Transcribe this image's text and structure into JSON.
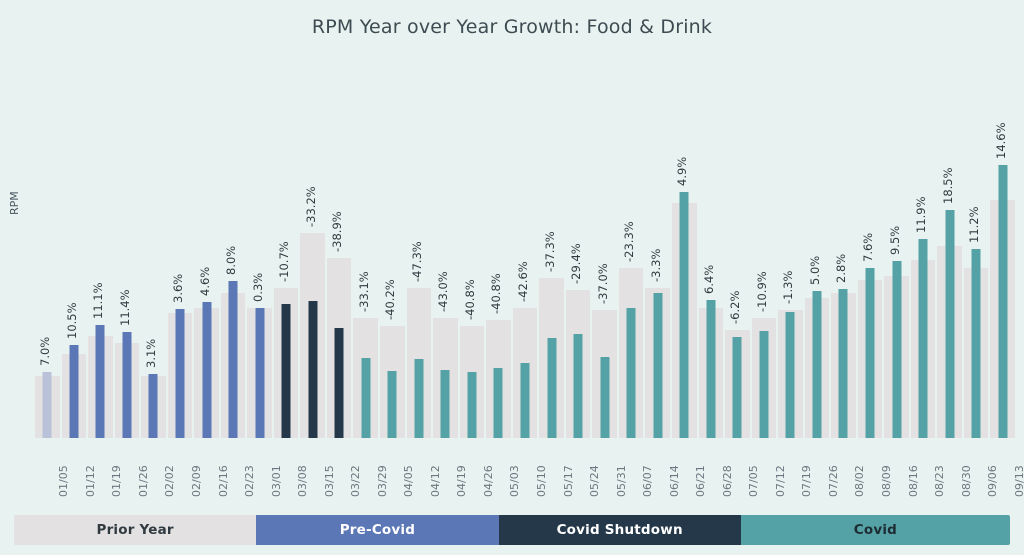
{
  "chart_data": {
    "type": "bar",
    "title": "RPM Year over Year Growth: Food & Drink",
    "xlabel": "",
    "ylabel": "RPM",
    "grid": false,
    "legend_position": "bottom",
    "categories": [
      "01/05",
      "01/12",
      "01/19",
      "01/26",
      "02/02",
      "02/09",
      "02/16",
      "02/23",
      "03/01",
      "03/08",
      "03/15",
      "03/22",
      "03/29",
      "04/05",
      "04/12",
      "04/19",
      "04/26",
      "05/03",
      "05/10",
      "05/17",
      "05/24",
      "05/31",
      "06/07",
      "06/14",
      "06/21",
      "06/28",
      "07/05",
      "07/12",
      "07/19",
      "07/26",
      "08/02",
      "08/09",
      "08/16",
      "08/23",
      "08/30",
      "09/06",
      "09/13"
    ],
    "series": [
      {
        "name": "Prior Year",
        "type": "background-bar",
        "color": "#e3e1e1",
        "values": [
          62,
          84,
          102,
          95,
          62,
          125,
          130,
          145,
          130,
          150,
          205,
          180,
          120,
          112,
          150,
          120,
          112,
          118,
          130,
          160,
          148,
          128,
          170,
          150,
          235,
          130,
          108,
          120,
          128,
          140,
          145,
          158,
          162,
          178,
          192,
          170,
          238
        ]
      },
      {
        "name": "Year over Year Growth",
        "type": "value-bar",
        "data_labels": [
          "7.0%",
          "10.5%",
          "11.1%",
          "11.4%",
          "3.1%",
          "3.6%",
          "4.6%",
          "8.0%",
          "0.3%",
          "-10.7%",
          "-33.2%",
          "-38.9%",
          "-33.1%",
          "-40.2%",
          "-47.3%",
          "-43.0%",
          "-40.8%",
          "-40.8%",
          "-42.6%",
          "-37.3%",
          "-29.4%",
          "-37.0%",
          "-23.3%",
          "-3.3%",
          "4.9%",
          "6.4%",
          "-6.2%",
          "-10.9%",
          "-1.3%",
          "5.0%",
          "2.8%",
          "7.6%",
          "9.5%",
          "11.9%",
          "18.5%",
          "11.2%",
          "14.6%"
        ],
        "values": [
          7.0,
          10.5,
          11.1,
          11.4,
          3.1,
          3.6,
          4.6,
          8.0,
          0.3,
          -10.7,
          -33.2,
          -38.9,
          -33.1,
          -40.2,
          -47.3,
          -43.0,
          -40.8,
          -40.8,
          -42.6,
          -37.3,
          -29.4,
          -37.0,
          -23.3,
          -3.3,
          4.9,
          6.4,
          -6.2,
          -10.9,
          -1.3,
          5.0,
          2.8,
          7.6,
          9.5,
          11.9,
          18.5,
          11.2,
          14.6
        ],
        "segments": [
          "prior",
          "pre",
          "pre",
          "pre",
          "pre",
          "pre",
          "pre",
          "pre",
          "pre",
          "shut",
          "shut",
          "shut",
          "covid",
          "covid",
          "covid",
          "covid",
          "covid",
          "covid",
          "covid",
          "covid",
          "covid",
          "covid",
          "covid",
          "covid",
          "covid",
          "covid",
          "covid",
          "covid",
          "covid",
          "covid",
          "covid",
          "covid",
          "covid",
          "covid",
          "covid",
          "covid",
          "covid"
        ]
      }
    ],
    "legend": [
      {
        "key": "prior",
        "label": "Prior Year",
        "color": "#e3e1e1",
        "text_color": "#303a40",
        "span": 9
      },
      {
        "key": "pre",
        "label": "Pre-Covid",
        "color": "#5b77b5",
        "text_color": "#ffffff",
        "span": 9
      },
      {
        "key": "shut",
        "label": "Covid Shutdown",
        "color": "#24384a",
        "text_color": "#ffffff",
        "span": 9
      },
      {
        "key": "covid",
        "label": "Covid",
        "color": "#55a2a6",
        "text_color": "#1d2c33",
        "span": 10
      }
    ],
    "colors": {
      "background": "#e8f2f0",
      "prior_bar": "#e3e1e1",
      "prior_year_bar": "#b9c2d8",
      "pre_covid_bar": "#5b77b5",
      "covid_shutdown_bar": "#24384a",
      "covid_bar": "#55a2a6",
      "title_text": "#3d4b52",
      "label_text": "#303a40",
      "tick_text": "#6b7780"
    }
  }
}
